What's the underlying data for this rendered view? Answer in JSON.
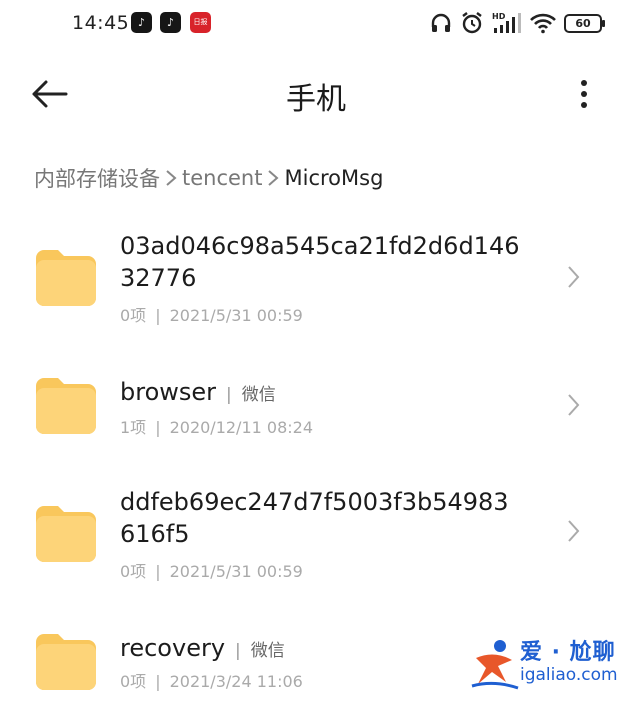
{
  "status_bar": {
    "time": "14:45",
    "app_icons": [
      "tiktok-icon",
      "tiktok-icon",
      "app-icon-red"
    ],
    "red_app_label": "日报",
    "battery": "60",
    "icons": [
      "headphones-icon",
      "alarm-icon",
      "signal-icon",
      "wifi-icon",
      "battery-icon"
    ]
  },
  "header": {
    "title": "手机",
    "back_icon": "arrow-left-icon",
    "more_icon": "more-vertical-icon"
  },
  "breadcrumb": {
    "items": [
      "内部存储设备",
      "tencent",
      "MicroMsg"
    ]
  },
  "files": [
    {
      "name": "03ad046c98a545ca21fd2d6d14632776",
      "name_line1": "03ad046c98a545ca21fd2d6d146",
      "name_line2": "32776",
      "tag": "",
      "count": "0项",
      "date": "2021/5/31 00:59"
    },
    {
      "name": "browser",
      "tag": "微信",
      "count": "1项",
      "date": "2020/12/11 08:24"
    },
    {
      "name": "ddfeb69ec247d7f5003f3b54983616f5",
      "name_line1": "ddfeb69ec247d7f5003f3b54983",
      "name_line2": "616f5",
      "tag": "",
      "count": "0项",
      "date": "2021/5/31 00:59"
    },
    {
      "name": "recovery",
      "tag": "微信",
      "count": "0项",
      "date": "2021/3/24 11:06"
    }
  ],
  "colors": {
    "folder": "#fdd479",
    "folder_tab": "#f9c75c",
    "watermark": "#1f5fd1",
    "watermark_accent": "#e8572a"
  },
  "watermark": {
    "brand": "爱 · 尬聊",
    "url": "igaliao.com"
  }
}
